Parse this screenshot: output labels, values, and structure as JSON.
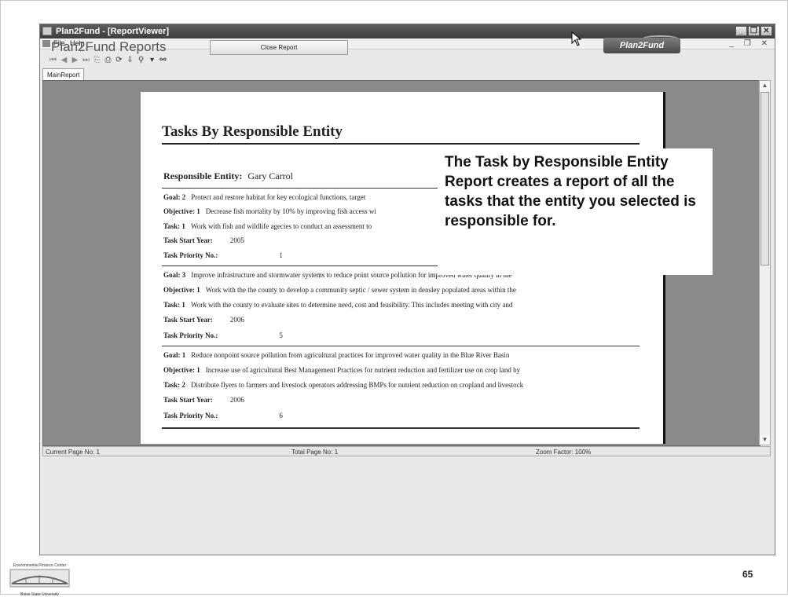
{
  "window": {
    "title": "Plan2Fund - [ReportViewer]",
    "menu": [
      "File",
      "Help"
    ]
  },
  "header": {
    "report_title": "Plan2Fund Reports",
    "close_button": "Close Report",
    "logo_text": "Plan2Fund",
    "toolbar_icons": [
      "first-page-icon",
      "prev-page-icon",
      "next-page-icon",
      "last-page-icon",
      "goto-page-icon",
      "print-icon",
      "refresh-icon",
      "export-icon",
      "zoom-icon",
      "dropdown-icon",
      "find-icon"
    ],
    "tab": "MainReport"
  },
  "report": {
    "title": "Tasks By Responsible Entity",
    "entity_label": "Responsible Entity:",
    "entity_value": "Gary Carrol",
    "groups": [
      {
        "goal_label": "Goal: 2",
        "goal_text": "Protect and restore habitat for key ecological functions, target",
        "objective_label": "Objective: 1",
        "objective_text": "Decrease fish mortality by 10% by improving fish access wi",
        "task_label": "Task: 1",
        "task_text": "Work with fish and wildlife agecies to conduct an assessment to",
        "start_label": "Task Start Year:",
        "start_value": "2005",
        "priority_label": "Task Priority No.:",
        "priority_value": "1"
      },
      {
        "goal_label": "Goal: 3",
        "goal_text": "Improve infrastructure and stormwater systems to reduce point source pollution for improved water quality in the",
        "objective_label": "Objective: 1",
        "objective_text": "Work with the the county to develop a community septic / sewer system in densley populated areas within the",
        "task_label": "Task: 1",
        "task_text": "Work with the county to evaluate sites to determine need, cost and feasibility.  This includes meeting with city and",
        "start_label": "Task Start Year:",
        "start_value": "2006",
        "priority_label": "Task Priority No.:",
        "priority_value": "5"
      },
      {
        "goal_label": "Goal: 1",
        "goal_text": "Reduce nonpoint source pollution from agricultural practices for improved water quality in the Blue River Basin",
        "objective_label": "Objective: 1",
        "objective_text": "Increase use of agricultural Best Management Practices for nutrient reduction and fertilizer use on crop land by",
        "task_label": "Task: 2",
        "task_text": "Distribute flyers to farmers and livestock operators addressing BMPs for nutrient reduction on cropland and livestock",
        "start_label": "Task Start Year:",
        "start_value": "2006",
        "priority_label": "Task Priority No.:",
        "priority_value": "6"
      }
    ]
  },
  "status": {
    "current_page": "Current Page No: 1",
    "total_page": "Total Page No: 1",
    "zoom": "Zoom Factor: 100%"
  },
  "callout": {
    "text": "The Task by Responsible Entity Report creates a report of all the tasks that the entity you selected is responsible for."
  },
  "footer": {
    "logo_top": "Environmental Finance Center",
    "logo_bottom": "Boise State University",
    "page_number": "65"
  }
}
